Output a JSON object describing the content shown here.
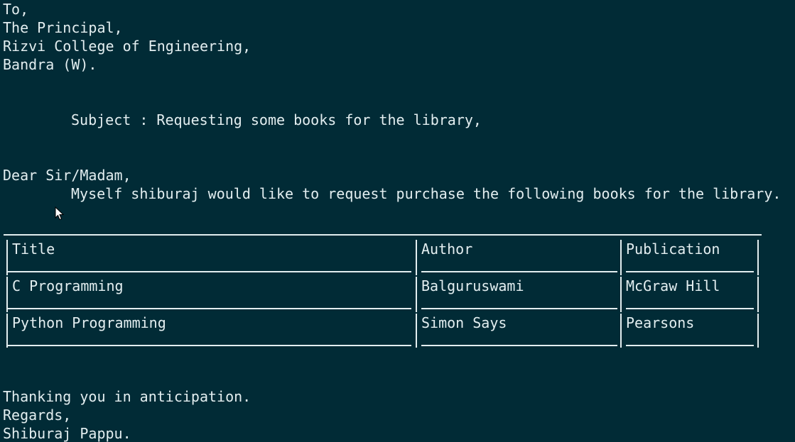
{
  "letter": {
    "to": "To,",
    "recipient": "The Principal,",
    "college": "Rizvi College of Engineering,",
    "location": "Bandra (W).",
    "subject": "Subject : Requesting some books for the library,",
    "salutation": "Dear Sir/Madam,",
    "body": "Myself shiburaj would like to request purchase the following books for the library.",
    "closing": "Thanking you in anticipation.",
    "regards": "Regards,",
    "signature": "Shiburaj Pappu."
  },
  "table": {
    "headers": [
      "Title",
      "Author",
      "Publication"
    ],
    "rows": [
      [
        "C Programming",
        "Balguruswami",
        "McGraw Hill"
      ],
      [
        "Python Programming",
        "Simon Says",
        "Pearsons"
      ]
    ]
  },
  "icons": {
    "pointer": "mouse-pointer-icon"
  },
  "colors": {
    "background": "#012b36",
    "text": "#e3eef0"
  }
}
